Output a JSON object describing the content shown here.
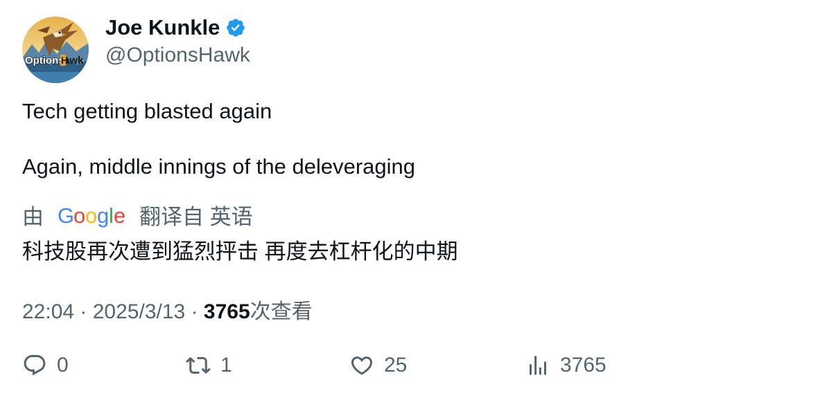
{
  "author": {
    "name": "Joe Kunkle",
    "handle": "@OptionsHawk",
    "avatar_text": "OptionsHawk",
    "verified_icon": "verified-badge-icon"
  },
  "tweet": {
    "line1": "Tech getting blasted again",
    "line2": "Again, middle innings of the deleveraging"
  },
  "translation": {
    "by_label": "由",
    "provider": "Google",
    "from_label": "翻译自 英语",
    "text": "科技股再次遭到猛烈抨击 再度去杠杆化的中期"
  },
  "meta": {
    "time": "22:04",
    "separator": " · ",
    "date": "2025/3/13",
    "views_count": "3765",
    "views_label": "次查看"
  },
  "actions": {
    "replies": "0",
    "reposts": "1",
    "likes": "25",
    "views": "3765"
  },
  "colors": {
    "text_primary": "#0f1419",
    "text_secondary": "#536471",
    "verified_blue": "#1d9bf0"
  }
}
